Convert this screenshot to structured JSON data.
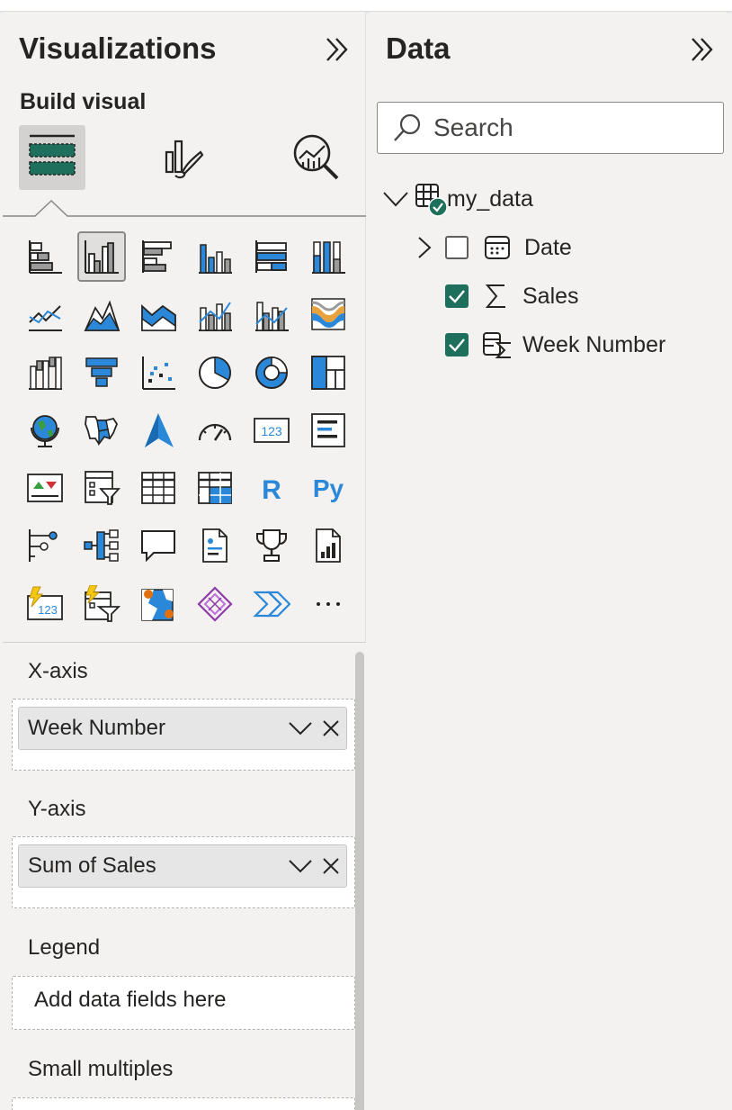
{
  "visualizations": {
    "title": "Visualizations",
    "build_visual_label": "Build visual",
    "tabs": [
      "build-visual",
      "format-visual",
      "analytics"
    ],
    "visual_icons": [
      "stacked-bar-chart",
      "clustered-column-chart",
      "clustered-bar-chart",
      "stacked-column-chart",
      "100-stacked-bar-chart",
      "100-stacked-column-chart",
      "line-chart",
      "area-chart",
      "stacked-area-chart",
      "line-and-stacked-column-chart",
      "line-and-clustered-column-chart",
      "ribbon-chart",
      "waterfall-chart",
      "funnel-chart",
      "scatter-chart",
      "pie-chart",
      "donut-chart",
      "treemap",
      "map",
      "filled-map",
      "azure-map",
      "gauge",
      "card",
      "multi-row-card",
      "kpi",
      "slicer",
      "table",
      "matrix",
      "r-script-visual",
      "python-visual",
      "key-influencers",
      "decomposition-tree",
      "qa",
      "smart-narrative",
      "metrics",
      "paginated-report",
      "power-automate-card",
      "power-automate-slicer",
      "arcgis-map",
      "power-apps",
      "power-automate",
      "more-visuals"
    ],
    "selected_visual": "clustered-column-chart",
    "r_label": "R",
    "py_label": "Py",
    "card_label": "123",
    "more_label": "···"
  },
  "wells": {
    "x_axis": {
      "label": "X-axis",
      "field": "Week Number"
    },
    "y_axis": {
      "label": "Y-axis",
      "field": "Sum of Sales"
    },
    "legend": {
      "label": "Legend",
      "placeholder": "Add data fields here"
    },
    "small_multiples": {
      "label": "Small multiples"
    }
  },
  "data_pane": {
    "title": "Data",
    "search_placeholder": "Search",
    "table": {
      "name": "my_data",
      "fields": [
        {
          "name": "Date",
          "checked": false,
          "expandable": true,
          "icon": "calendar-icon"
        },
        {
          "name": "Sales",
          "checked": true,
          "expandable": false,
          "icon": "sigma-icon"
        },
        {
          "name": "Week Number",
          "checked": true,
          "expandable": false,
          "icon": "calculated-column-icon"
        }
      ]
    }
  },
  "colors": {
    "accent_green": "#1e6f5c",
    "icon_blue": "#2b88d8",
    "icon_gray": "#605e5c",
    "pane_bg": "#f3f2f1"
  }
}
